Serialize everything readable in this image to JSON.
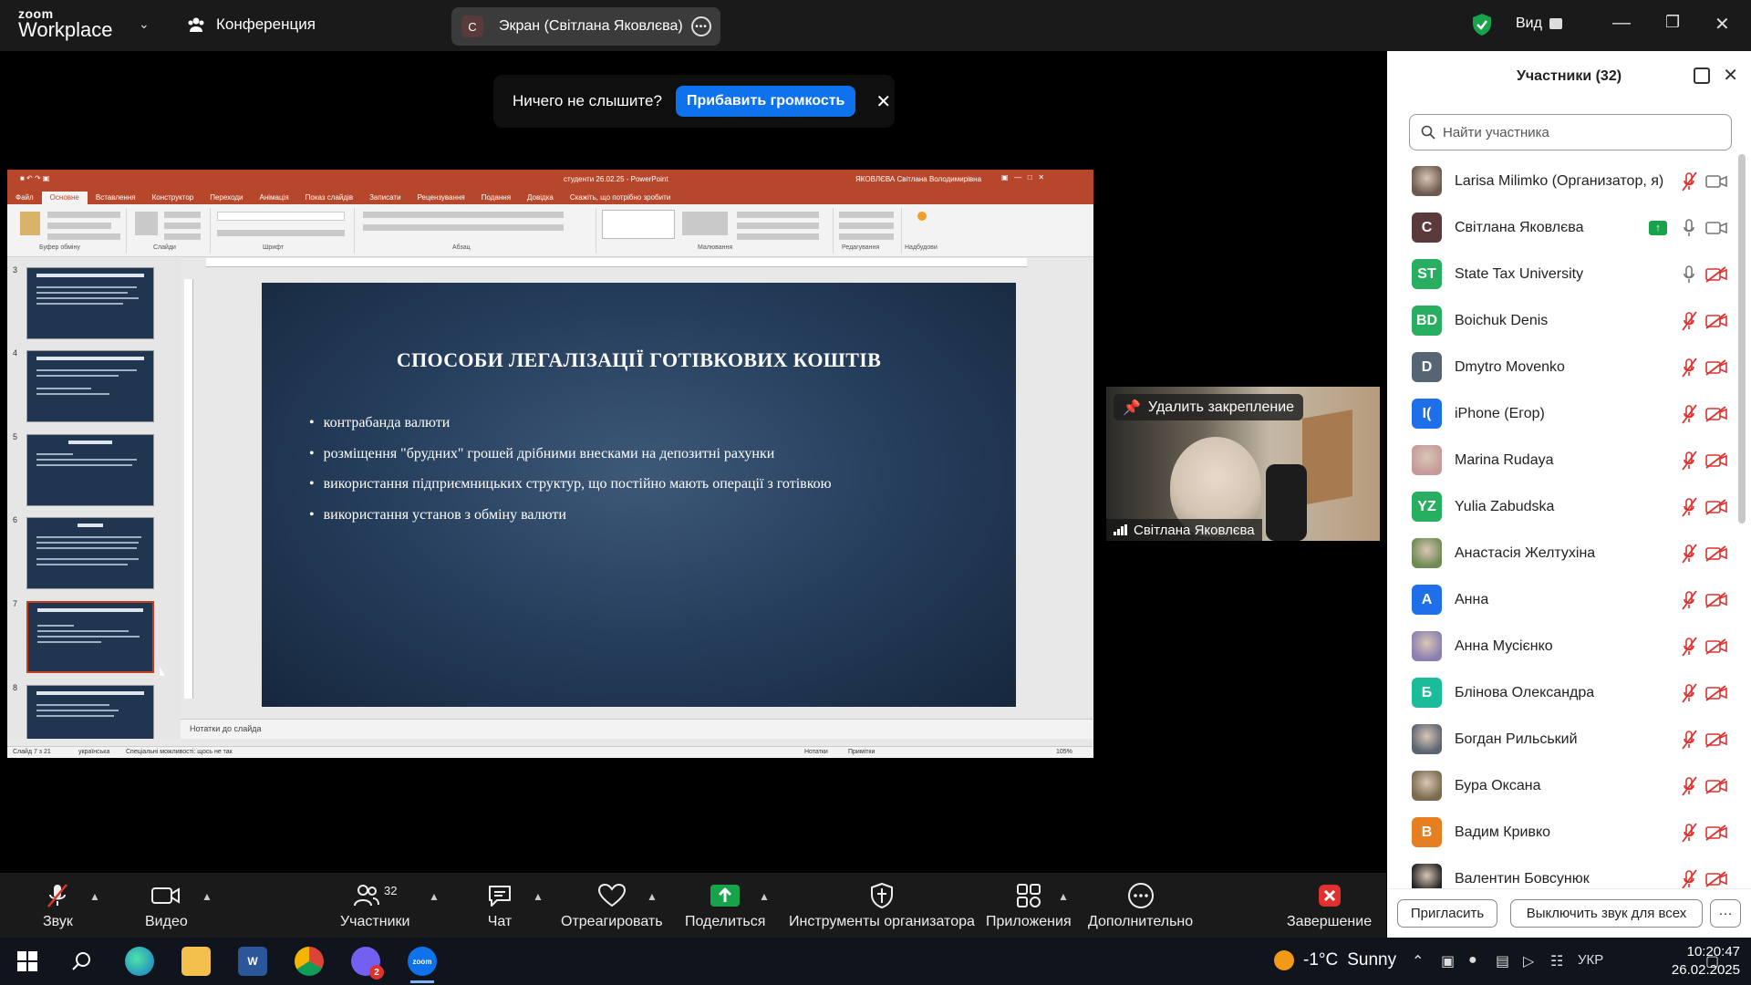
{
  "app": {
    "logo_line1": "zoom",
    "logo_line2": "Workplace",
    "meeting_label": "Конференция",
    "screen_share_label": "Экран (Світлана Яковлєва)",
    "screen_share_initial": "C",
    "view_label": "Вид"
  },
  "notice": {
    "text": "Ничего не слышите?",
    "button": "Прибавить громкость"
  },
  "powerpoint": {
    "doc_title": "студенти 26.02.25 - PowerPoint",
    "user": "ЯКОВЛЄВА Світлана Володимирівна",
    "tabs": [
      "Файл",
      "Основне",
      "Вставлення",
      "Конструктор",
      "Переходи",
      "Анімація",
      "Показ слайдів",
      "Записати",
      "Рецензування",
      "Подання",
      "Довідка",
      "Скажіть, що потрібно зробити"
    ],
    "ribbon_groups": [
      "Буфер обміну",
      "Слайди",
      "Шрифт",
      "Абзац",
      "Малювання",
      "Редагування",
      "Надбудови"
    ],
    "thumb_numbers": [
      "3",
      "4",
      "5",
      "6",
      "7",
      "8"
    ],
    "selected_thumb": "7",
    "slide_title": "СПОСОБИ ЛЕГАЛІЗАЦІЇ ГОТІВКОВИХ КОШТІВ",
    "bullets": [
      "контрабанда валюти",
      "розміщення \"брудних\" грошей дрібними внесками на депозитні рахунки",
      "використання підприємницьких структур, що постійно мають операції з готівкою",
      "використання установ з обміну валюти"
    ],
    "notes_placeholder": "Нотатки до слайда",
    "status_slide": "Слайд 7 з 21",
    "status_lang": "українська",
    "status_access": "Спеціальні можливості: щось не так",
    "status_notes": "Нотатки",
    "status_comments": "Примітки",
    "zoom_level": "105%"
  },
  "video": {
    "pin_label": "Удалить закрепление",
    "name": "Світлана Яковлєва"
  },
  "participants": {
    "title": "Участники (32)",
    "search_placeholder": "Найти участника",
    "items": [
      {
        "initials": "",
        "name": "Larisa Milimko (Организатор, я)",
        "color": "#6b5a4e",
        "photo": true,
        "mic": "muted",
        "cam": "on-grey"
      },
      {
        "initials": "C",
        "name": "Світлана Яковлєва",
        "color": "#5a3a3a",
        "photo": false,
        "mic": "on",
        "cam": "on-grey",
        "sharing": true
      },
      {
        "initials": "ST",
        "name": "State Tax University",
        "color": "#27ae60",
        "photo": false,
        "mic": "on",
        "cam": "off"
      },
      {
        "initials": "BD",
        "name": "Boichuk Denis",
        "color": "#27ae60",
        "photo": false,
        "mic": "muted",
        "cam": "off"
      },
      {
        "initials": "D",
        "name": "Dmytro Movenko",
        "color": "#566573",
        "photo": false,
        "mic": "muted",
        "cam": "off"
      },
      {
        "initials": "I(",
        "name": "iPhone (Егор)",
        "color": "#1f6feb",
        "photo": false,
        "mic": "muted",
        "cam": "off"
      },
      {
        "initials": "",
        "name": "Marina Rudaya",
        "color": "#c79a9a",
        "photo": true,
        "mic": "muted",
        "cam": "off"
      },
      {
        "initials": "YZ",
        "name": "Yulia Zabudska",
        "color": "#27ae60",
        "photo": false,
        "mic": "muted",
        "cam": "off"
      },
      {
        "initials": "",
        "name": "Анастасія Желтухіна",
        "color": "#6f8b55",
        "photo": true,
        "mic": "muted",
        "cam": "off"
      },
      {
        "initials": "A",
        "name": "Анна",
        "color": "#1f6feb",
        "photo": false,
        "mic": "muted",
        "cam": "off"
      },
      {
        "initials": "",
        "name": "Анна Мусієнко",
        "color": "#8a7fb0",
        "photo": true,
        "mic": "muted",
        "cam": "off"
      },
      {
        "initials": "Б",
        "name": "Блінова Олександра",
        "color": "#1abc9c",
        "photo": false,
        "mic": "muted",
        "cam": "off"
      },
      {
        "initials": "",
        "name": "Богдан Рильський",
        "color": "#5b6470",
        "photo": true,
        "mic": "muted",
        "cam": "off"
      },
      {
        "initials": "",
        "name": "Бура Оксана",
        "color": "#7a6a4f",
        "photo": true,
        "mic": "muted",
        "cam": "off"
      },
      {
        "initials": "В",
        "name": "Вадим Кривко",
        "color": "#e67e22",
        "photo": false,
        "mic": "muted",
        "cam": "off"
      },
      {
        "initials": "",
        "name": "Валентин Бовсунюк",
        "color": "#222222",
        "photo": true,
        "mic": "muted",
        "cam": "off"
      }
    ],
    "invite_label": "Пригласить",
    "mute_all_label": "Выключить звук для всех",
    "more_label": "···"
  },
  "toolbar": {
    "audio": "Звук",
    "video": "Видео",
    "participants": "Участники",
    "participants_count": "32",
    "chat": "Чат",
    "react": "Отреагировать",
    "share": "Поделиться",
    "host_tools": "Инструменты организатора",
    "apps": "Приложения",
    "more": "Дополнительно",
    "end": "Завершение"
  },
  "taskbar": {
    "weather_temp": "-1°C",
    "weather_desc": "Sunny",
    "lang": "УКР",
    "time": "10:20:47",
    "date": "26.02.2025",
    "viber_badge": "2"
  },
  "colors": {
    "accent_blue": "#0e72ed",
    "ppt_red": "#b7472a",
    "share_green": "#17a34a",
    "muted_red": "#e0312f"
  }
}
